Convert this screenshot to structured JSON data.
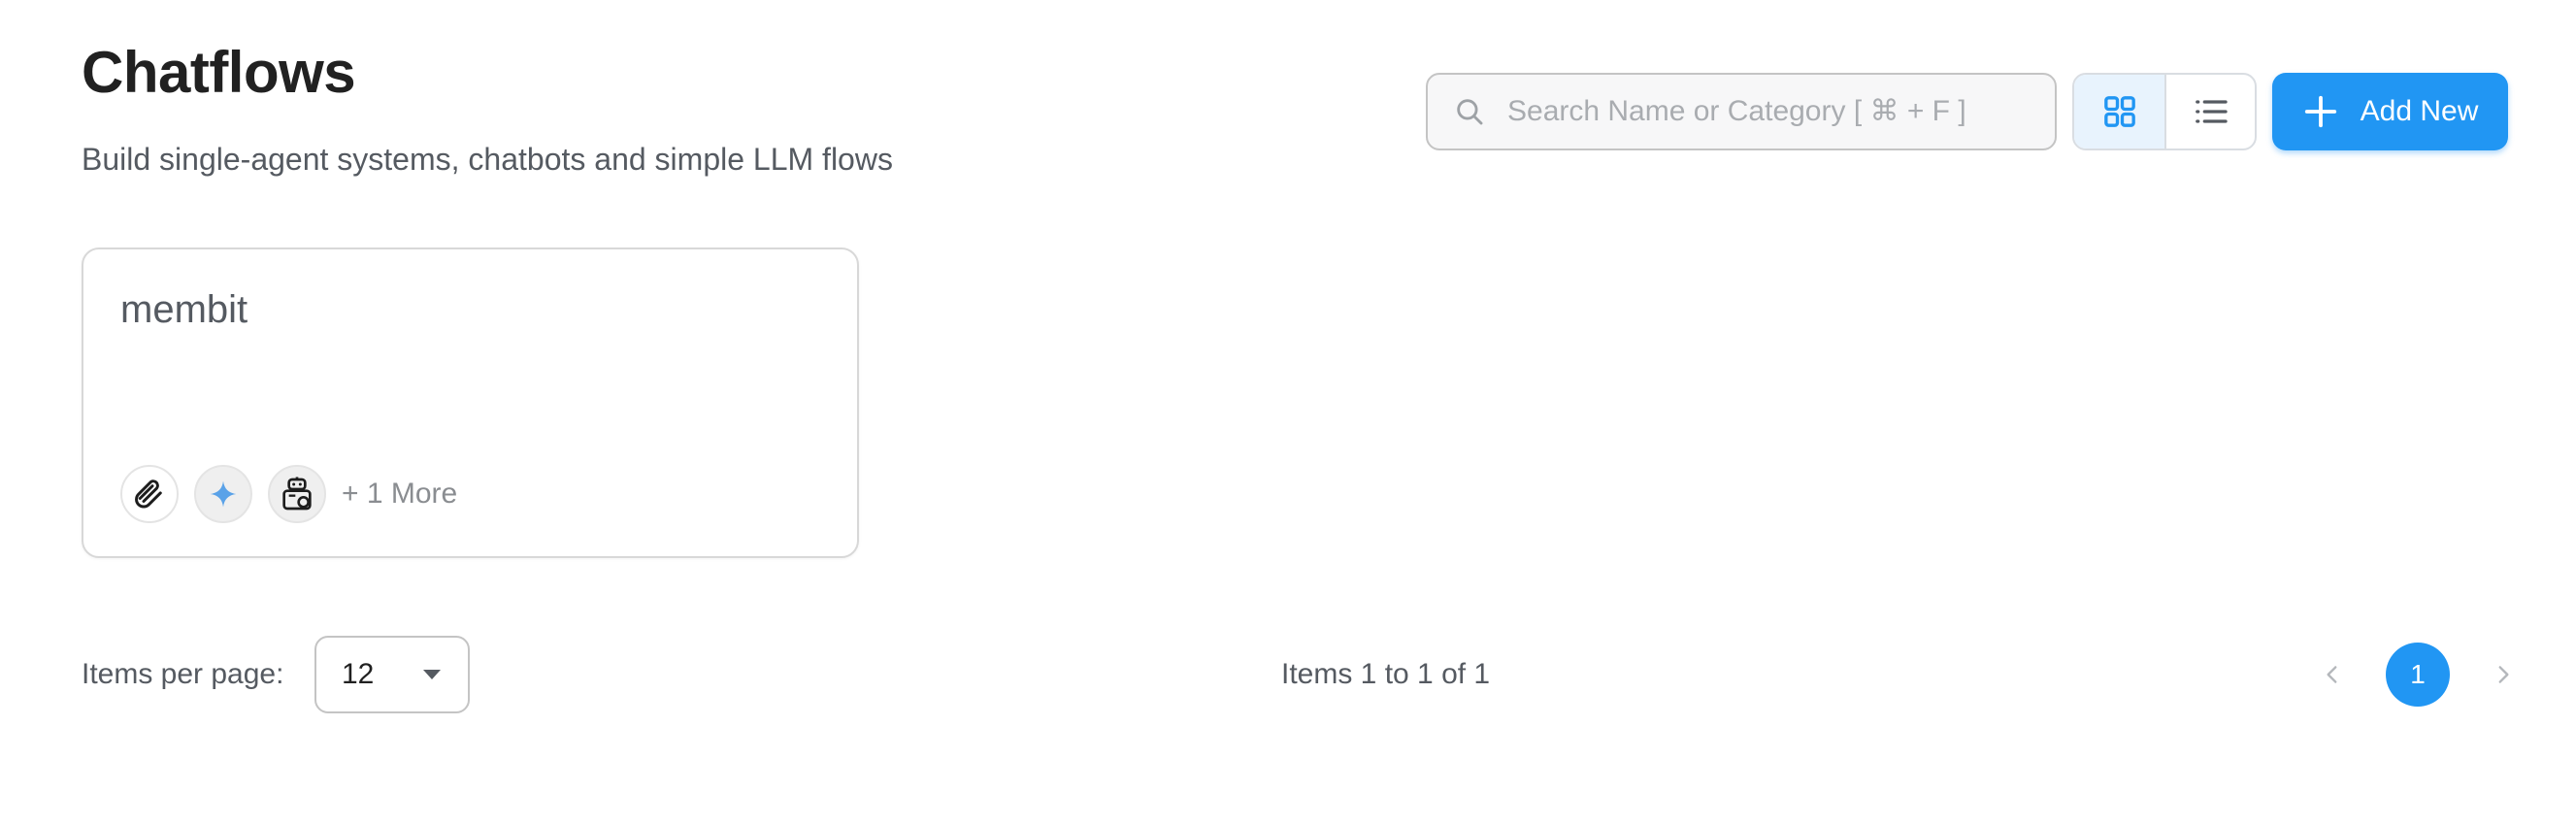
{
  "header": {
    "title": "Chatflows",
    "subtitle": "Build single-agent systems, chatbots and simple LLM flows"
  },
  "search": {
    "placeholder": "Search Name or Category [ ⌘ + F ]",
    "value": ""
  },
  "view_toggle": {
    "active": "grid"
  },
  "add_button": {
    "label": "Add New"
  },
  "cards": [
    {
      "name": "membit",
      "node_icons": [
        "paperclip-icon",
        "sparkle-icon",
        "robot-icon"
      ],
      "more_label": "+ 1 More"
    }
  ],
  "pagination": {
    "items_per_page_label": "Items per page:",
    "items_per_page_value": "12",
    "summary": "Items 1 to 1 of 1",
    "current_page": "1"
  },
  "colors": {
    "accent": "#2196f3",
    "active_toggle_bg": "#e8f3fd"
  }
}
